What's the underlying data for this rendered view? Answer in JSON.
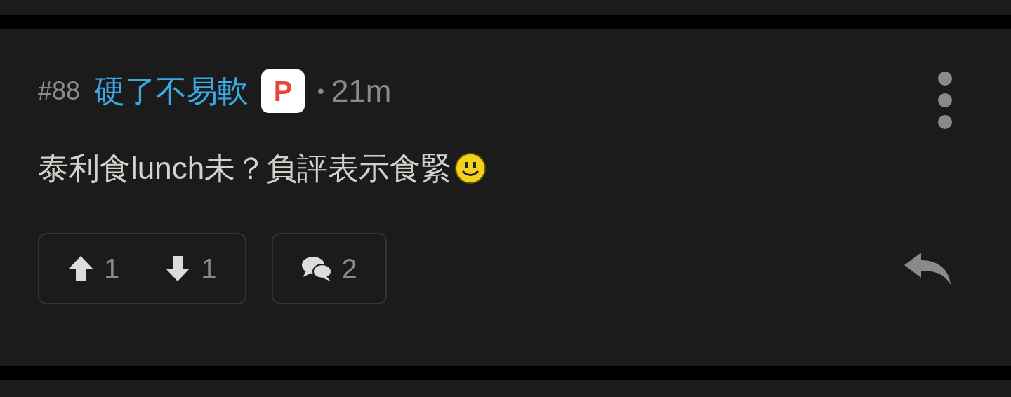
{
  "post": {
    "number": "#88",
    "username": "硬了不易軟",
    "badge": "P",
    "separator": "•",
    "time": "21m"
  },
  "body": "泰利食lunch未？負評表示食緊",
  "actions": {
    "upvotes": "1",
    "downvotes": "1",
    "comments": "2"
  }
}
